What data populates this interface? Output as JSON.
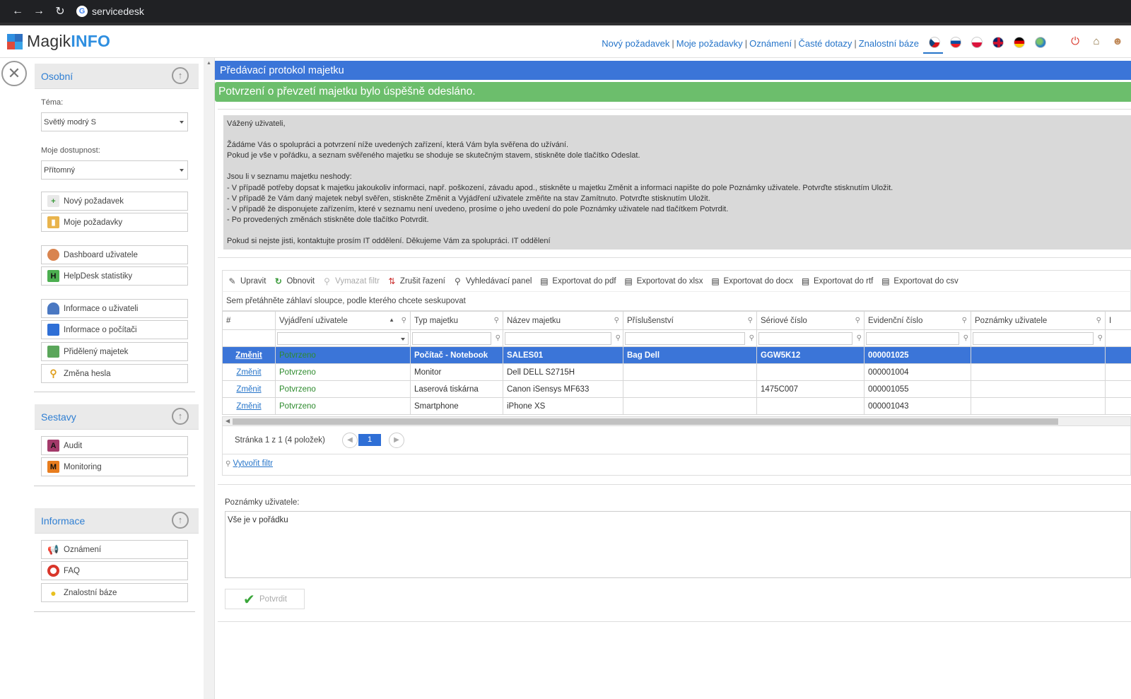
{
  "browser": {
    "url": "servicedesk"
  },
  "header": {
    "logo_magik": "Magik",
    "logo_info": "INFO",
    "links": [
      "Nový požadavek",
      "Moje požadavky",
      "Oznámení",
      "Časté dotazy",
      "Znalostní báze"
    ],
    "separator": "|"
  },
  "sidebar": {
    "section_personal": "Osobní",
    "theme_label": "Téma:",
    "theme_value": "Světlý modrý S",
    "availability_label": "Moje dostupnost:",
    "availability_value": "Přítomný",
    "buttons_1": [
      "Nový požadavek",
      "Moje požadavky"
    ],
    "buttons_2": [
      "Dashboard uživatele",
      "HelpDesk statistiky"
    ],
    "buttons_3": [
      "Informace o uživateli",
      "Informace o počítači",
      "Přidělený majetek",
      "Změna hesla"
    ],
    "section_reports": "Sestavy",
    "reports": [
      "Audit",
      "Monitoring"
    ],
    "section_info": "Informace",
    "info_items": [
      "Oznámení",
      "FAQ",
      "Znalostní báze"
    ]
  },
  "main": {
    "title": "Předávací protokol majetku",
    "success": "Potvrzení o převzetí majetku bylo úspěšně odesláno.",
    "info_lines": [
      "Vážený uživateli,",
      "",
      "Žádáme Vás o spolupráci a potvrzení níže uvedených zařízení, která Vám byla svěřena do užívání.",
      "Pokud je vše v pořádku, a seznam svěřeného majetku se shoduje se skutečným stavem, stiskněte dole tlačítko Odeslat.",
      "",
      "Jsou li v seznamu majetku neshody:",
      "- V případě potřeby dopsat k majetku jakoukoliv informaci, např. poškození, závadu apod., stiskněte u majetku Změnit a informaci napište do pole Poznámky uživatele. Potvrďte stisknutím Uložit.",
      "- V případě že Vám daný majetek nebyl svěřen, stiskněte Změnit a Vyjádření uživatele změňte na stav Zamítnuto. Potvrďte stisknutím Uložit.",
      "- V případě že disponujete zařízením, které v seznamu není uvedeno, prosíme o jeho uvedení do pole Poznámky uživatele nad tlačítkem Potvrdit.",
      "- Po provedených změnách stiskněte dole tlačítko Potvrdit.",
      "",
      "Pokud si nejste jisti, kontaktujte prosím IT oddělení. Děkujeme Vám za spolupráci. IT oddělení"
    ],
    "toolbar": [
      "Upravit",
      "Obnovit",
      "Vymazat filtr",
      "Zrušit řazení",
      "Vyhledávací panel",
      "Exportovat do pdf",
      "Exportovat do xlsx",
      "Exportovat do docx",
      "Exportovat do rtf",
      "Exportovat do csv"
    ],
    "group_hint": "Sem přetáhněte záhlaví sloupce, podle kterého chcete seskupovat",
    "columns": [
      "#",
      "Vyjádření uživatele",
      "Typ majetku",
      "Název majetku",
      "Příslušenství",
      "Sériové číslo",
      "Evidenční číslo",
      "Poznámky uživatele",
      "I"
    ],
    "rows": [
      {
        "action": "Změnit",
        "status": "Potvrzeno",
        "type": "Počítač - Notebook",
        "name": "SALES01",
        "accessory": "Bag Dell",
        "serial": "GGW5K12",
        "evid": "000001025",
        "notes": ""
      },
      {
        "action": "Změnit",
        "status": "Potvrzeno",
        "type": "Monitor",
        "name": "Dell DELL S2715H",
        "accessory": "",
        "serial": "",
        "evid": "000001004",
        "notes": ""
      },
      {
        "action": "Změnit",
        "status": "Potvrzeno",
        "type": "Laserová tiskárna",
        "name": "Canon iSensys MF633",
        "accessory": "",
        "serial": "1475C007",
        "evid": "000001055",
        "notes": ""
      },
      {
        "action": "Změnit",
        "status": "Potvrzeno",
        "type": "Smartphone",
        "name": "iPhone XS",
        "accessory": "",
        "serial": "",
        "evid": "000001043",
        "notes": ""
      }
    ],
    "pager_text": "Stránka 1 z 1 (4 položek)",
    "page_current": "1",
    "create_filter": "Vytvořit filtr",
    "notes_label": "Poznámky uživatele:",
    "notes_value": "Vše je v pořádku",
    "confirm_label": "Potvrdit"
  },
  "colors": {
    "accent": "#3b75d8",
    "success": "#6cbe6c",
    "status_green": "#2e8b2e"
  }
}
